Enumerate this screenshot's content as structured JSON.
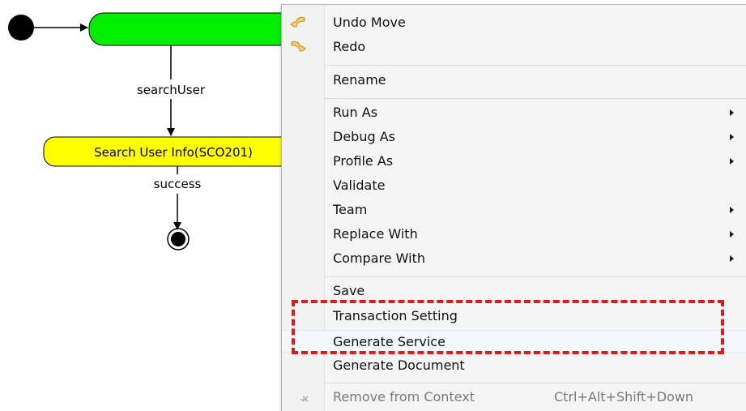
{
  "diagram": {
    "action_node_1": {
      "label": "",
      "fill": "#00ee00"
    },
    "transition_1": {
      "label": "searchUser"
    },
    "action_node_2": {
      "label": "Search User Info(SCO201)",
      "fill": "#ffff00"
    },
    "transition_2": {
      "label": "success"
    }
  },
  "context_menu": {
    "undo_move": {
      "label": "Undo Move",
      "icon": "undo-arrow-icon"
    },
    "redo": {
      "label": "Redo",
      "icon": "redo-arrow-icon"
    },
    "rename": {
      "label": "Rename"
    },
    "run_as": {
      "label": "Run As"
    },
    "debug_as": {
      "label": "Debug As"
    },
    "profile_as": {
      "label": "Profile As"
    },
    "validate": {
      "label": "Validate"
    },
    "team": {
      "label": "Team"
    },
    "replace_with": {
      "label": "Replace With"
    },
    "compare_with": {
      "label": "Compare With"
    },
    "save": {
      "label": "Save"
    },
    "transaction_setting": {
      "label": "Transaction Setting"
    },
    "generate_service": {
      "label": "Generate Service"
    },
    "generate_document": {
      "label": "Generate Document"
    },
    "remove_from_context": {
      "label": "Remove from Context",
      "accelerator": "Ctrl+Alt+Shift+Down",
      "icon": "remove-context-icon"
    }
  },
  "colors": {
    "highlight_box": "#e31818",
    "menu_background": "#f5f5f5",
    "icon_arrow": "#f0b84a"
  }
}
